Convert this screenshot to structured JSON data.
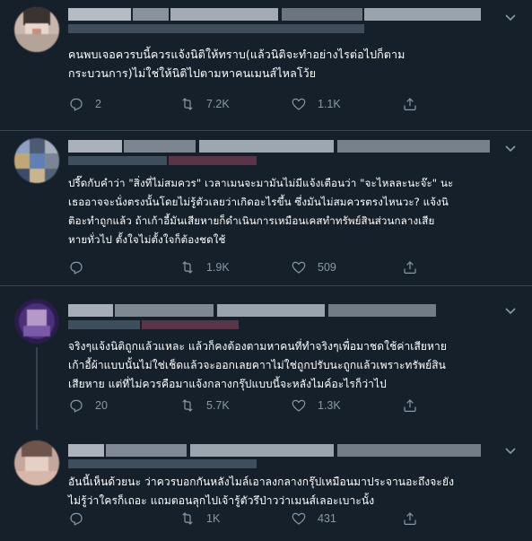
{
  "tweets": [
    {
      "lines": [
        "คนพบเจอควรบนี้ควรแจ้งนิติให้ทราบ(แล้วนิติจะทำอย่างไรต่อไปก็ตาม",
        "กระบวนการ)ไม่ใช่ให้นิติไปตามหาคนเมนส์ไหลโว้ย"
      ],
      "replies": "2",
      "retweets": "7.2K",
      "likes": "1.1K"
    },
    {
      "lines": [
        "ปรี๊ดกับคำว่า \"สิ่งที่ไม่สมควร\" เวลาเมนจะมามันไม่มีแจ้งเตือนว่า \"จะไหลละนะจ๊ะ\" นะ",
        "เธออาจจะนั่งตรงนั้นโดยไม่รู้ตัวเลยว่าเกิดอะไรขึ้น ซึ่งมันไม่สมควรตรงไหนวะ? แจ้งนิ",
        "ติอะทำถูกแล้ว ถ้าเก้าอี้มันเสียหายก็ดำเนินการเหมือนเคสทำทรัพย์สินส่วนกลางเสีย",
        "หายทั่วไป ตั้งใจไม่ตั้งใจก็ต้องชดใช้"
      ],
      "replies": "",
      "retweets": "1.9K",
      "likes": "509"
    },
    {
      "lines": [
        "จริงๆแจ้งนิติถูกแล้วแหละ แล้วก็คงต้องตามหาคนที่ทำจริงๆเพื่อมาชดใช้ค่าเสียหาย",
        "เก้าอี้ผ้าแบบนั้นไม่ใช่เช็ดแล้วจะออกเลยคาาไม่ใช่ถูกปรับนะถูกแล้วเพราะทรัพย์สิน",
        "เสียหาย แต่ที่ไม่ควรคือมาแจ้งกลางกรุ๊ปแบบนี้จะหลังไมค์อะไรก็ว่าไป"
      ],
      "replies": "20",
      "retweets": "5.7K",
      "likes": "1.3K"
    },
    {
      "lines": [
        "อันนี้เห็นด้วยนะ ว่าควรบอกกันหลังไมล์เอาลงกลางกรุ๊ปเหมือนมาประจานอะถึงจะยัง",
        "ไม่รู้ว่าใครก็เถอะ แถมตอนลุกไปเจ้ารู้ตัวรึป่าวว่าเมนส์เลอะเบาะนั้ง"
      ],
      "replies": "",
      "retweets": "1K",
      "likes": "431"
    }
  ],
  "colors": {
    "background": "#15202b",
    "muted": "#8b98a5",
    "divider": "#38444d"
  },
  "icons": {
    "reply": "reply-icon",
    "retweet": "retweet-icon",
    "like": "like-icon",
    "share": "share-icon",
    "more": "more-caret-icon"
  }
}
